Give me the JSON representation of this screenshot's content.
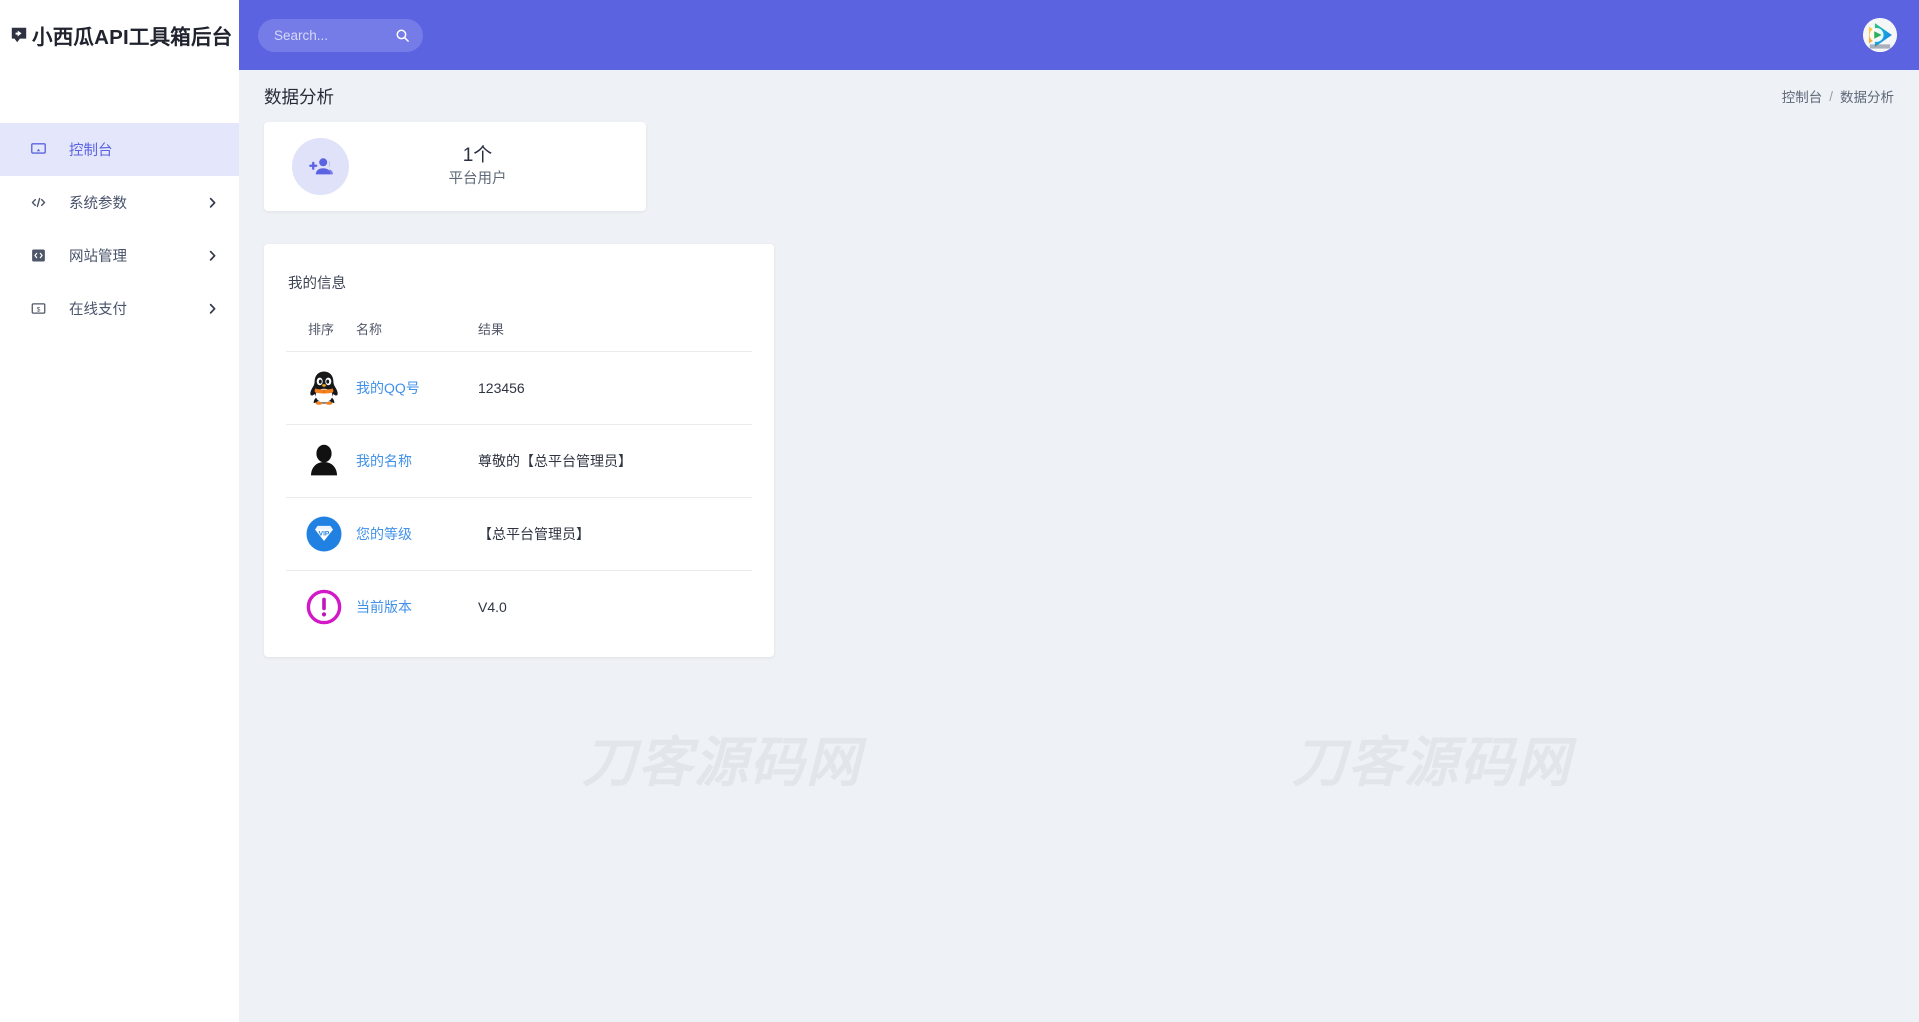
{
  "brand": {
    "icon": "app-logo-icon",
    "title": "小西瓜API工具箱后台"
  },
  "sidebar": {
    "items": [
      {
        "label": "控制台",
        "icon": "monitor-icon",
        "active": true,
        "has_arrow": false
      },
      {
        "label": "系统参数",
        "icon": "code-brackets-icon",
        "active": false,
        "has_arrow": true
      },
      {
        "label": "网站管理",
        "icon": "code-box-icon",
        "active": false,
        "has_arrow": true
      },
      {
        "label": "在线支付",
        "icon": "money-bill-icon",
        "active": false,
        "has_arrow": true
      }
    ]
  },
  "header": {
    "search": {
      "placeholder": "Search...",
      "value": "",
      "icon": "search-icon"
    },
    "avatar": {
      "name": "user-avatar",
      "alt": "腾讯视频头像"
    },
    "background": "#5b63e0"
  },
  "page": {
    "title": "数据分析",
    "breadcrumb": {
      "parent": "控制台",
      "separator": "/",
      "current": "数据分析"
    }
  },
  "stat_card": {
    "icon": "add-user-icon",
    "value": "1个",
    "label": "平台用户",
    "icon_color": "#5b63e0",
    "icon_bg": "#e0e2fa"
  },
  "info_card": {
    "title": "我的信息",
    "columns": [
      "排序",
      "名称",
      "结果"
    ],
    "rows": [
      {
        "icon": "qq-penguin-icon",
        "name": "我的QQ号",
        "result": "123456"
      },
      {
        "icon": "user-silhouette-icon",
        "name": "我的名称",
        "result": "尊敬的【总平台管理员】"
      },
      {
        "icon": "vip-diamond-icon",
        "name": "您的等级",
        "result": "【总平台管理员】"
      },
      {
        "icon": "exclamation-circle-icon",
        "name": "当前版本",
        "result": "V4.0"
      }
    ]
  },
  "watermarks": {
    "left": "刀客源码网",
    "right": "刀客源码网"
  },
  "colors": {
    "accent": "#5b63e0",
    "sidebar_active_bg": "#e4e7fb",
    "page_bg": "#eef1f5",
    "card_bg": "#ffffff",
    "link": "#4191e8",
    "watermark": "#e2e6eb"
  }
}
